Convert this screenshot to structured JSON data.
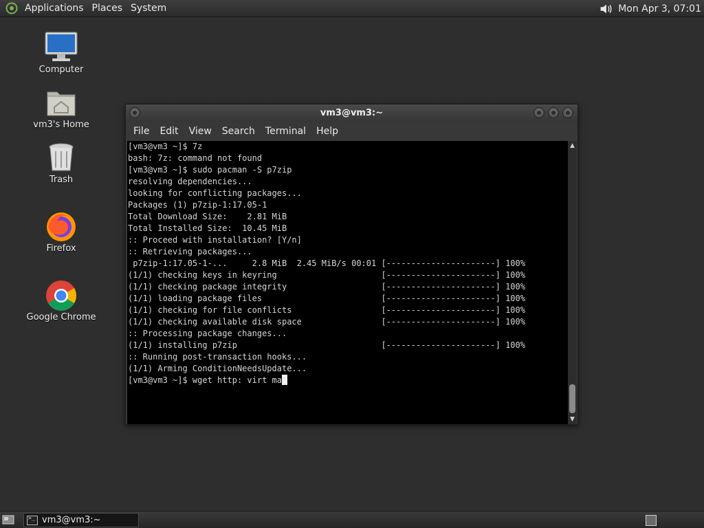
{
  "top_panel": {
    "menus": [
      "Applications",
      "Places",
      "System"
    ],
    "clock": "Mon Apr  3, 07:01"
  },
  "desktop_icons": [
    {
      "label": "Computer",
      "icon": "computer-icon"
    },
    {
      "label": "vm3's Home",
      "icon": "home-folder-icon"
    },
    {
      "label": "Trash",
      "icon": "trash-icon"
    },
    {
      "label": "Firefox",
      "icon": "firefox-icon"
    },
    {
      "label": "Google Chrome",
      "icon": "chrome-icon"
    }
  ],
  "terminal": {
    "title": "vm3@vm3:~",
    "menu": [
      "File",
      "Edit",
      "View",
      "Search",
      "Terminal",
      "Help"
    ],
    "lines": [
      "[vm3@vm3 ~]$ 7z",
      "bash: 7z: command not found",
      "[vm3@vm3 ~]$ sudo pacman -S p7zip",
      "resolving dependencies...",
      "looking for conflicting packages...",
      "",
      "Packages (1) p7zip-1:17.05-1",
      "",
      "Total Download Size:    2.81 MiB",
      "Total Installed Size:  10.45 MiB",
      "",
      ":: Proceed with installation? [Y/n]",
      ":: Retrieving packages...",
      " p7zip-1:17.05-1-...     2.8 MiB  2.45 MiB/s 00:01 [----------------------] 100%",
      "(1/1) checking keys in keyring                     [----------------------] 100%",
      "(1/1) checking package integrity                   [----------------------] 100%",
      "(1/1) loading package files                        [----------------------] 100%",
      "(1/1) checking for file conflicts                  [----------------------] 100%",
      "(1/1) checking available disk space                [----------------------] 100%",
      ":: Processing package changes...",
      "(1/1) installing p7zip                             [----------------------] 100%",
      ":: Running post-transaction hooks...",
      "(1/1) Arming ConditionNeedsUpdate..."
    ],
    "prompt_line": "[vm3@vm3 ~]$ wget http: virt ma"
  },
  "taskbar": {
    "task_label": "vm3@vm3:~"
  }
}
